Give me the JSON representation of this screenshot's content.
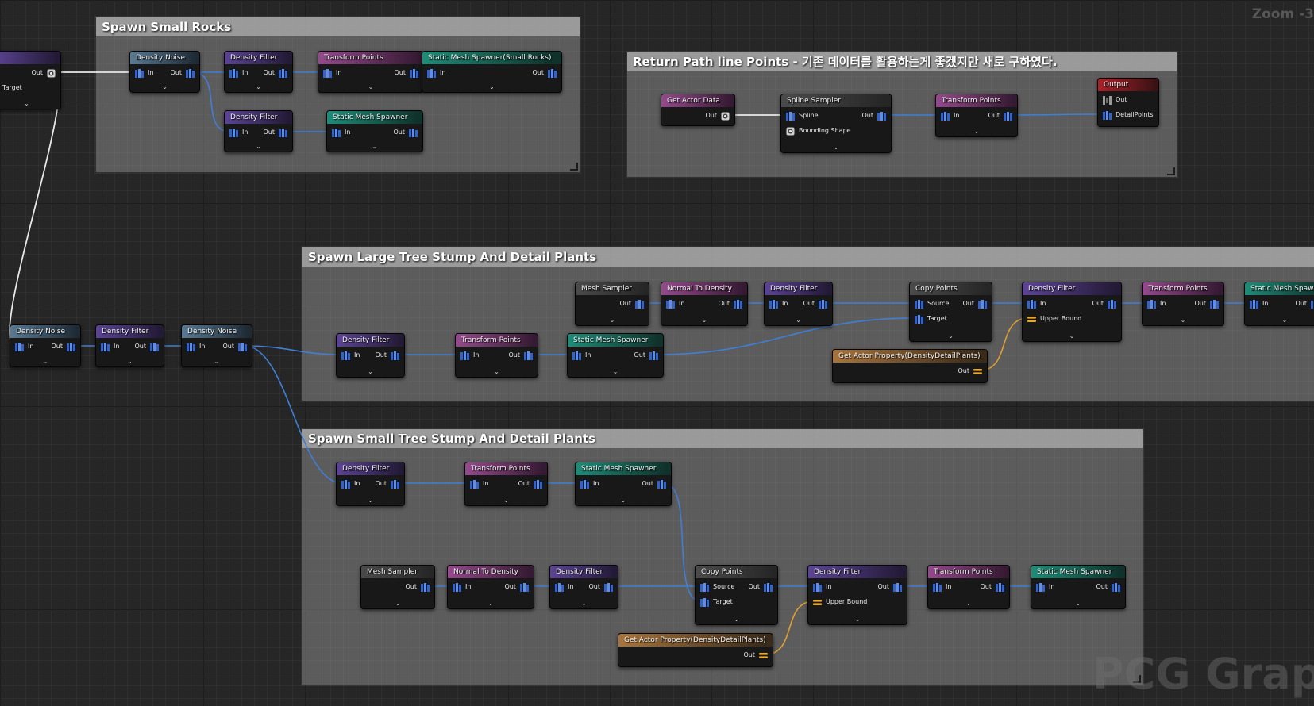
{
  "zoom_label": "Zoom -3",
  "watermark": "PCG Graph",
  "colors": {
    "wire_points": "#3f7fd6",
    "wire_actor": "#e8e8e8",
    "wire_float": "#e0a030",
    "pin_points": "#2f63d0",
    "pin_float": "#e8a82a"
  },
  "comments": [
    {
      "id": "c1",
      "title": "Spawn Small Rocks"
    },
    {
      "id": "c2",
      "title": "Return Path line Points - 기존 데이터를 활용하는게 좋겠지만 새로 구하였다."
    },
    {
      "id": "c3",
      "title": "Spawn Large Tree Stump And Detail Plants"
    },
    {
      "id": "c4",
      "title": "Spawn Small Tree Stump And Detail Plants"
    }
  ],
  "nodes": [
    {
      "id": "n0",
      "title": "",
      "header": "purple",
      "inputs": [],
      "inputsIcon": [],
      "outputs": [
        "Out"
      ],
      "outIcon": "actor",
      "extra": "Target",
      "chevron": true
    },
    {
      "id": "r1",
      "title": "Density Noise",
      "header": "blue",
      "inputs": [
        "In"
      ],
      "outputs": [
        "Out"
      ],
      "chevron": true
    },
    {
      "id": "r2",
      "title": "Density Filter",
      "header": "purple",
      "inputs": [
        "In"
      ],
      "outputs": [
        "Out"
      ],
      "chevron": true
    },
    {
      "id": "r3",
      "title": "Transform Points",
      "header": "pink",
      "inputs": [
        "In"
      ],
      "outputs": [
        "Out"
      ],
      "chevron": true
    },
    {
      "id": "r4",
      "title": "Static Mesh Spawner(Small Rocks)",
      "header": "teal",
      "inputs": [
        "In"
      ],
      "outputs": [
        "Out"
      ],
      "chevron": true
    },
    {
      "id": "r5",
      "title": "Density Filter",
      "header": "purple",
      "inputs": [
        "In"
      ],
      "outputs": [
        "Out"
      ],
      "chevron": true
    },
    {
      "id": "r6",
      "title": "Static Mesh Spawner",
      "header": "teal",
      "inputs": [
        "In"
      ],
      "outputs": [
        "Out"
      ],
      "chevron": true
    },
    {
      "id": "p1",
      "title": "Get Actor Data",
      "header": "pink",
      "inputs": [],
      "outputs": [
        "Out"
      ],
      "outIcon": "actor",
      "chevron": false
    },
    {
      "id": "p2",
      "title": "Spline Sampler",
      "header": "gray",
      "inputs": [
        "Spline",
        "Bounding Shape"
      ],
      "inputIcons": [
        "points",
        "actor"
      ],
      "outputs": [
        "Out"
      ],
      "chevron": true
    },
    {
      "id": "p3",
      "title": "Transform Points",
      "header": "pink",
      "inputs": [
        "In"
      ],
      "outputs": [
        "Out"
      ],
      "chevron": true
    },
    {
      "id": "p4",
      "title": "Output",
      "header": "red",
      "inputs": [
        "Out",
        "DetailPoints"
      ],
      "inputIcons": [
        "any",
        "points"
      ],
      "outputs": [],
      "chevron": false
    },
    {
      "id": "m1",
      "title": "Density Noise",
      "header": "blue",
      "inputs": [
        "In"
      ],
      "outputs": [
        "Out"
      ],
      "chevron": true
    },
    {
      "id": "m2",
      "title": "Density Filter",
      "header": "purple",
      "inputs": [
        "In"
      ],
      "outputs": [
        "Out"
      ],
      "chevron": true
    },
    {
      "id": "m3",
      "title": "Density Noise",
      "header": "blue",
      "inputs": [
        "In"
      ],
      "outputs": [
        "Out"
      ],
      "chevron": true
    },
    {
      "id": "l1",
      "title": "Density Filter",
      "header": "purple",
      "inputs": [
        "In"
      ],
      "outputs": [
        "Out"
      ],
      "chevron": true
    },
    {
      "id": "l2",
      "title": "Transform Points",
      "header": "pink",
      "inputs": [
        "In"
      ],
      "outputs": [
        "Out"
      ],
      "chevron": true
    },
    {
      "id": "l3",
      "title": "Static Mesh Spawner",
      "header": "teal",
      "inputs": [
        "In"
      ],
      "outputs": [
        "Out"
      ],
      "chevron": true
    },
    {
      "id": "l4",
      "title": "Mesh Sampler",
      "header": "gray",
      "inputs": [],
      "outputs": [
        "Out"
      ],
      "chevron": true
    },
    {
      "id": "l5",
      "title": "Normal To Density",
      "header": "pink",
      "inputs": [
        "In"
      ],
      "outputs": [
        "Out"
      ],
      "chevron": true
    },
    {
      "id": "l6",
      "title": "Density Filter",
      "header": "purple",
      "inputs": [
        "In"
      ],
      "outputs": [
        "Out"
      ],
      "chevron": true
    },
    {
      "id": "l7",
      "title": "Copy Points",
      "header": "gray",
      "inputs": [
        "Source",
        "Target"
      ],
      "outputs": [
        "Out"
      ],
      "chevron": true
    },
    {
      "id": "l8",
      "title": "Get Actor Property(DensityDetailPlants)",
      "header": "orange",
      "inputs": [],
      "outputs": [
        "Out"
      ],
      "outIcon": "float",
      "chevron": false
    },
    {
      "id": "l9",
      "title": "Density Filter",
      "header": "purple",
      "inputs": [
        "In",
        "Upper Bound"
      ],
      "inputIcons": [
        "points",
        "float"
      ],
      "outputs": [
        "Out"
      ],
      "chevron": true
    },
    {
      "id": "l10",
      "title": "Transform Points",
      "header": "pink",
      "inputs": [
        "In"
      ],
      "outputs": [
        "Out"
      ],
      "chevron": true
    },
    {
      "id": "l11",
      "title": "Static Mesh Spawner",
      "header": "teal",
      "inputs": [
        "In"
      ],
      "outputs": [
        "Out"
      ],
      "chevron": true
    },
    {
      "id": "s1",
      "title": "Density Filter",
      "header": "purple",
      "inputs": [
        "In"
      ],
      "outputs": [
        "Out"
      ],
      "chevron": true
    },
    {
      "id": "s2",
      "title": "Transform Points",
      "header": "pink",
      "inputs": [
        "In"
      ],
      "outputs": [
        "Out"
      ],
      "chevron": true
    },
    {
      "id": "s3",
      "title": "Static Mesh Spawner",
      "header": "teal",
      "inputs": [
        "In"
      ],
      "outputs": [
        "Out"
      ],
      "chevron": true
    },
    {
      "id": "s4",
      "title": "Mesh Sampler",
      "header": "gray",
      "inputs": [],
      "outputs": [
        "Out"
      ],
      "chevron": true
    },
    {
      "id": "s5",
      "title": "Normal To Density",
      "header": "pink",
      "inputs": [
        "In"
      ],
      "outputs": [
        "Out"
      ],
      "chevron": true
    },
    {
      "id": "s6",
      "title": "Density Filter",
      "header": "purple",
      "inputs": [
        "In"
      ],
      "outputs": [
        "Out"
      ],
      "chevron": true
    },
    {
      "id": "s7",
      "title": "Copy Points",
      "header": "gray",
      "inputs": [
        "Source",
        "Target"
      ],
      "outputs": [
        "Out"
      ],
      "chevron": true
    },
    {
      "id": "s8",
      "title": "Get Actor Property(DensityDetailPlants)",
      "header": "orange",
      "inputs": [],
      "outputs": [
        "Out"
      ],
      "outIcon": "float",
      "chevron": false
    },
    {
      "id": "s9",
      "title": "Density Filter",
      "header": "purple",
      "inputs": [
        "In",
        "Upper Bound"
      ],
      "inputIcons": [
        "points",
        "float"
      ],
      "outputs": [
        "Out"
      ],
      "chevron": true
    },
    {
      "id": "s10",
      "title": "Transform Points",
      "header": "pink",
      "inputs": [
        "In"
      ],
      "outputs": [
        "Out"
      ],
      "chevron": true
    },
    {
      "id": "s11",
      "title": "Static Mesh Spawner",
      "header": "teal",
      "inputs": [
        "In"
      ],
      "outputs": [
        "Out"
      ],
      "chevron": true
    }
  ],
  "wires": [
    {
      "from": "n0.out0",
      "to": "r1.in0",
      "kind": "actor"
    },
    {
      "from": "n0.out0",
      "to": "m1.in0",
      "kind": "actor"
    },
    {
      "from": "r1.out0",
      "to": "r2.in0",
      "kind": "points"
    },
    {
      "from": "r1.out0",
      "to": "r5.in0",
      "kind": "points"
    },
    {
      "from": "r2.out0",
      "to": "r3.in0",
      "kind": "points"
    },
    {
      "from": "r3.out0",
      "to": "r4.in0",
      "kind": "points"
    },
    {
      "from": "r5.out0",
      "to": "r6.in0",
      "kind": "points"
    },
    {
      "from": "p1.out0",
      "to": "p2.in0",
      "kind": "actor"
    },
    {
      "from": "p2.out0",
      "to": "p3.in0",
      "kind": "points"
    },
    {
      "from": "p3.out0",
      "to": "p4.in1",
      "kind": "points"
    },
    {
      "from": "m1.out0",
      "to": "m2.in0",
      "kind": "points"
    },
    {
      "from": "m2.out0",
      "to": "m3.in0",
      "kind": "points"
    },
    {
      "from": "m3.out0",
      "to": "l1.in0",
      "kind": "points"
    },
    {
      "from": "m3.out0",
      "to": "s1.in0",
      "kind": "points"
    },
    {
      "from": "l1.out0",
      "to": "l2.in0",
      "kind": "points"
    },
    {
      "from": "l2.out0",
      "to": "l3.in0",
      "kind": "points"
    },
    {
      "from": "l3.out0",
      "to": "l7.in1",
      "kind": "points"
    },
    {
      "from": "l4.out0",
      "to": "l5.in0",
      "kind": "points"
    },
    {
      "from": "l5.out0",
      "to": "l6.in0",
      "kind": "points"
    },
    {
      "from": "l6.out0",
      "to": "l7.in0",
      "kind": "points"
    },
    {
      "from": "l7.out0",
      "to": "l9.in0",
      "kind": "points"
    },
    {
      "from": "l8.out0",
      "to": "l9.in1",
      "kind": "float"
    },
    {
      "from": "l9.out0",
      "to": "l10.in0",
      "kind": "points"
    },
    {
      "from": "l10.out0",
      "to": "l11.in0",
      "kind": "points"
    },
    {
      "from": "s1.out0",
      "to": "s2.in0",
      "kind": "points"
    },
    {
      "from": "s2.out0",
      "to": "s3.in0",
      "kind": "points"
    },
    {
      "from": "s3.out0",
      "to": "s7.in1",
      "kind": "points"
    },
    {
      "from": "s4.out0",
      "to": "s5.in0",
      "kind": "points"
    },
    {
      "from": "s5.out0",
      "to": "s6.in0",
      "kind": "points"
    },
    {
      "from": "s6.out0",
      "to": "s7.in0",
      "kind": "points"
    },
    {
      "from": "s7.out0",
      "to": "s9.in0",
      "kind": "points"
    },
    {
      "from": "s8.out0",
      "to": "s9.in1",
      "kind": "float"
    },
    {
      "from": "s9.out0",
      "to": "s10.in0",
      "kind": "points"
    },
    {
      "from": "s10.out0",
      "to": "s11.in0",
      "kind": "points"
    }
  ]
}
